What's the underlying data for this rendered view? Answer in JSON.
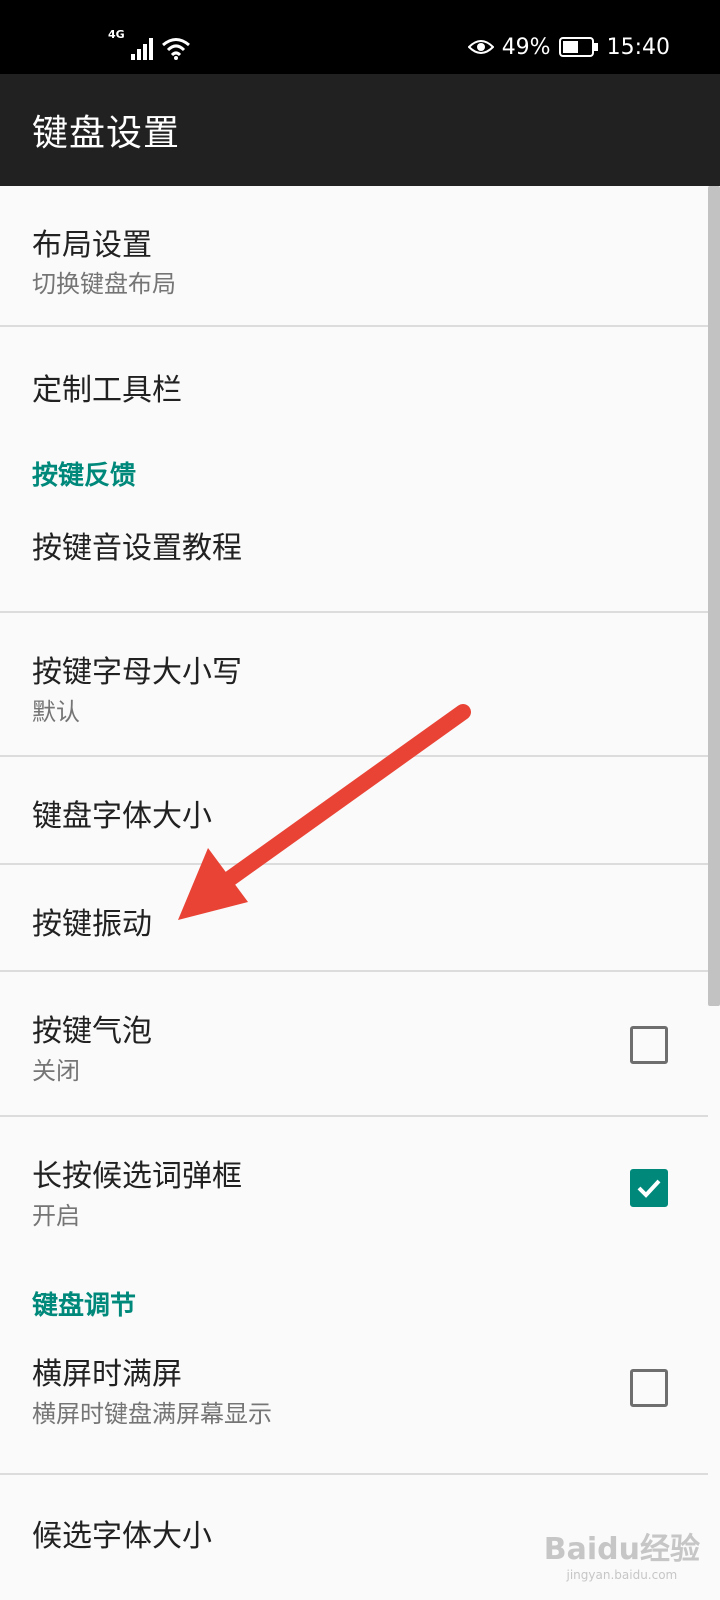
{
  "status_bar": {
    "network": "4G",
    "battery_percent": "49%",
    "time": "15:40",
    "icons": [
      "signal-icon",
      "wifi-icon",
      "eye-icon",
      "battery-icon"
    ]
  },
  "app_bar": {
    "title": "键盘设置"
  },
  "items": [
    {
      "title": "布局设置",
      "subtitle": "切换键盘布局"
    },
    {
      "title": "定制工具栏"
    }
  ],
  "category_feedback": {
    "title": "按键反馈"
  },
  "feedback_items": [
    {
      "title": "按键音设置教程"
    },
    {
      "title": "按键字母大小写",
      "subtitle": "默认"
    },
    {
      "title": "键盘字体大小"
    },
    {
      "title": "按键振动"
    },
    {
      "title": "按键气泡",
      "subtitle": "关闭",
      "checked": false
    },
    {
      "title": "长按候选词弹框",
      "subtitle": "开启",
      "checked": true
    }
  ],
  "category_adjust": {
    "title": "键盘调节"
  },
  "adjust_items": [
    {
      "title": "横屏时满屏",
      "subtitle": "横屏时键盘满屏幕显示",
      "checked": false
    },
    {
      "title": "候选字体大小"
    }
  ],
  "watermark": {
    "logo": "Baidu经验",
    "url": "jingyan.baidu.com"
  },
  "colors": {
    "accent": "#00897b",
    "annotation_arrow": "#e94335",
    "app_bar": "#212121"
  }
}
